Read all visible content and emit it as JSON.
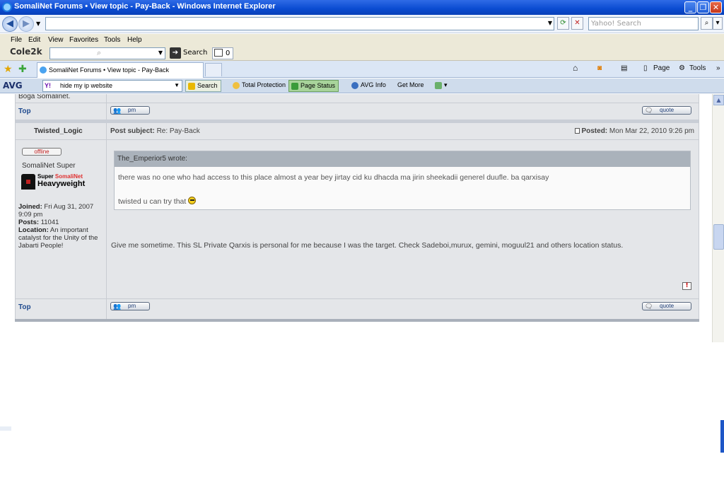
{
  "window": {
    "title": "SomaliNet Forums • View topic - Pay-Back - Windows Internet Explorer",
    "minimize": "_",
    "maximize": "❐",
    "close": "✕"
  },
  "address": {
    "url": "",
    "search_placeholder": "Yahoo! Search"
  },
  "menu": [
    "File",
    "Edit",
    "View",
    "Favorites",
    "Tools",
    "Help"
  ],
  "cole": {
    "brand": "Cole2k",
    "search_label": "Search",
    "counter": "0"
  },
  "tabs": {
    "active_tab": "SomaliNet Forums • View topic - Pay-Back",
    "page_label": "Page",
    "tools_label": "Tools"
  },
  "avg": {
    "brand": "AVG",
    "search_value": "hide my ip website",
    "search_label": "Search",
    "total_protection": "Total Protection",
    "page_status": "Page Status",
    "avg_info": "AVG Info",
    "get_more": "Get More"
  },
  "forum": {
    "prev_post_tail": "Boga Somalinet.",
    "top_label": "Top",
    "pm_label": "pm",
    "quote_label": "quote",
    "post": {
      "author": "Twisted_Logic",
      "subject_label": "Post subject:",
      "subject": "Re: Pay-Back",
      "posted_label": "Posted:",
      "posted": "Mon Mar 22, 2010 9:26 pm",
      "status": "offline",
      "rank": "SomaliNet Super",
      "rank_image_line1_a": "Super ",
      "rank_image_line1_b": "SomaliNet",
      "rank_image_line2": "Heavyweight",
      "joined_label": "Joined:",
      "joined": "Fri Aug 31, 2007 9:09 pm",
      "posts_label": "Posts:",
      "posts": "11041",
      "location_label": "Location:",
      "location": "An important catalyst for the Unity of the Jabarti People!",
      "quote_author": "The_Emperior5 wrote:",
      "quote_line1": "there was no one who had access to this place almost a year bey jirtay cid ku dhacda ma jirin sheekadii generel duufle. ba qarxisay",
      "quote_line2": "twisted u can try that",
      "body": "Give me sometime. This SL Private Qarxis is personal for me because I was the target. Check Sadeboi,murux, gemini, moguul21 and others location status.",
      "report": "!"
    }
  }
}
